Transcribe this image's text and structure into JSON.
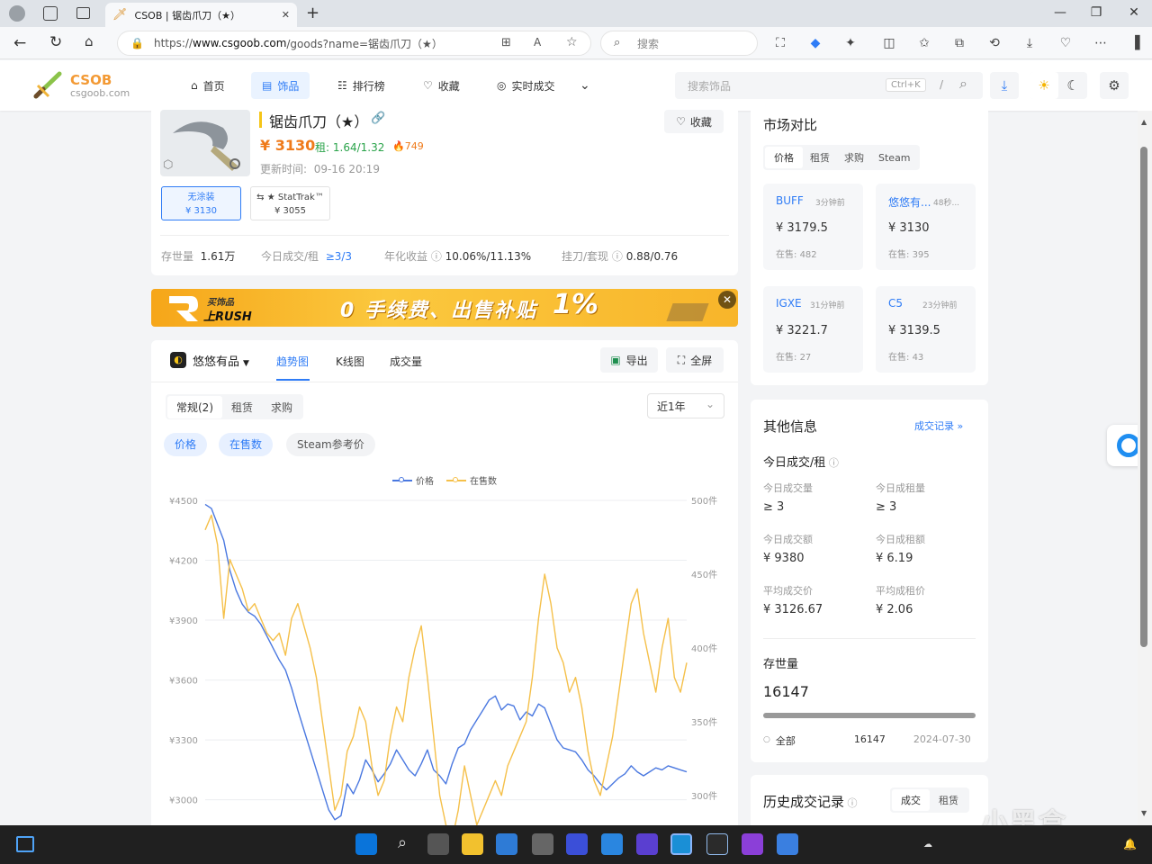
{
  "browser": {
    "tab_title": "CSOB | 锯齿爪刀（★）",
    "url_prefix": "https://",
    "url_host": "www.csgoob.com",
    "url_path": "/goods?name=锯齿爪刀（★）",
    "search_placeholder": "搜索",
    "tab_close": "✕",
    "new_tab": "+"
  },
  "site": {
    "logo_title": "CSOB",
    "logo_sub": "csgoob.com",
    "nav": [
      "首页",
      "饰品",
      "排行榜",
      "收藏",
      "实时成交"
    ],
    "search_placeholder": "搜索饰品",
    "shortcut": "Ctrl+K",
    "slash": "/"
  },
  "item": {
    "name": "锯齿爪刀（★）",
    "fav_label": "收藏",
    "price": "¥ 3130",
    "rent_label": "租:",
    "rent_value": "1.64/1.32",
    "hot": "749",
    "updated_label": "更新时间:",
    "updated_value": "09-16 20:19",
    "variants": [
      {
        "name": "无涂装",
        "price": "¥ 3130"
      },
      {
        "name": "★ StatTrak™",
        "price": "¥ 3055"
      }
    ],
    "stats": [
      {
        "label": "存世量",
        "value": "1.61万"
      },
      {
        "label": "今日成交/租",
        "value": "≥3/3"
      },
      {
        "label": "年化收益",
        "value": "10.06%/11.13%"
      },
      {
        "label": "挂刀/套现",
        "value": "0.88/0.76"
      }
    ]
  },
  "banner": {
    "brand_top": "买饰品",
    "brand_bottom": "上RUSH",
    "slogan": "0 手续费、出售补贴",
    "highlight": "1%"
  },
  "chart_panel": {
    "platform": "悠悠有品",
    "tabs": [
      "趋势图",
      "K线图",
      "成交量"
    ],
    "export": "导出",
    "fullscreen": "全屏",
    "subtabs": [
      "常规(2)",
      "租赁",
      "求购"
    ],
    "range": "近1年",
    "pills": [
      "价格",
      "在售数",
      "Steam参考价"
    ],
    "legend": [
      "价格",
      "在售数"
    ]
  },
  "chart_data": {
    "type": "line",
    "y_left_ticks": [
      "¥4500",
      "¥4200",
      "¥3900",
      "¥3600",
      "¥3300",
      "¥3000"
    ],
    "y_right_ticks": [
      "500件",
      "450件",
      "400件",
      "350件",
      "300件"
    ],
    "ylim_left": [
      2800,
      4500
    ],
    "ylim_right": [
      270,
      500
    ],
    "series": [
      {
        "name": "价格",
        "color": "#4a78e0",
        "values": [
          4480,
          4460,
          4380,
          4300,
          4150,
          4050,
          3980,
          3940,
          3920,
          3880,
          3820,
          3760,
          3700,
          3650,
          3560,
          3450,
          3350,
          3250,
          3150,
          3050,
          2950,
          2900,
          2920,
          3080,
          3030,
          3100,
          3200,
          3150,
          3090,
          3130,
          3180,
          3250,
          3200,
          3150,
          3120,
          3180,
          3250,
          3150,
          3120,
          3080,
          3180,
          3260,
          3280,
          3350,
          3400,
          3450,
          3500,
          3520,
          3450,
          3480,
          3470,
          3400,
          3440,
          3420,
          3480,
          3460,
          3380,
          3300,
          3260,
          3250,
          3240,
          3200,
          3150,
          3120,
          3080,
          3050,
          3080,
          3110,
          3130,
          3170,
          3140,
          3120,
          3140,
          3160,
          3150,
          3170,
          3160,
          3150,
          3140
        ]
      },
      {
        "name": "在售数",
        "color": "#f5c04a",
        "values": [
          480,
          490,
          470,
          420,
          460,
          450,
          440,
          425,
          430,
          420,
          410,
          405,
          410,
          395,
          420,
          430,
          415,
          400,
          380,
          350,
          320,
          290,
          300,
          330,
          340,
          360,
          350,
          320,
          300,
          310,
          340,
          360,
          350,
          380,
          400,
          415,
          380,
          340,
          300,
          280,
          270,
          290,
          320,
          300,
          280,
          290,
          300,
          310,
          300,
          320,
          330,
          340,
          350,
          380,
          420,
          450,
          430,
          400,
          390,
          370,
          380,
          360,
          330,
          310,
          300,
          320,
          340,
          370,
          400,
          430,
          440,
          410,
          390,
          370,
          400,
          420,
          380,
          370,
          390
        ]
      }
    ]
  },
  "market": {
    "title": "市场对比",
    "tabs": [
      "价格",
      "租赁",
      "求购",
      "Steam"
    ],
    "cards": [
      {
        "name": "BUFF",
        "time": "3分钟前",
        "price": "¥ 3179.5",
        "count_label": "在售:",
        "count": "482"
      },
      {
        "name": "悠悠有...",
        "time": "48秒...",
        "price": "¥ 3130",
        "count_label": "在售:",
        "count": "395"
      },
      {
        "name": "IGXE",
        "time": "31分钟前",
        "price": "¥ 3221.7",
        "count_label": "在售:",
        "count": "27"
      },
      {
        "name": "C5",
        "time": "23分钟前",
        "price": "¥ 3139.5",
        "count_label": "在售:",
        "count": "43"
      }
    ]
  },
  "other": {
    "title": "其他信息",
    "link": "成交记录",
    "section": "今日成交/租",
    "metrics": [
      {
        "label": "今日成交量",
        "value": "≥ 3"
      },
      {
        "label": "今日成租量",
        "value": "≥ 3"
      },
      {
        "label": "今日成交额",
        "value": "¥ 9380"
      },
      {
        "label": "今日成租额",
        "value": "¥ 6.19"
      },
      {
        "label": "平均成交价",
        "value": "¥ 3126.67"
      },
      {
        "label": "平均成租价",
        "value": "¥ 2.06"
      }
    ],
    "stock_title": "存世量",
    "stock_value": "16147",
    "stock_row": {
      "label": "全部",
      "value": "16147",
      "date": "2024-07-30"
    }
  },
  "history": {
    "title": "历史成交记录",
    "tabs": [
      "成交",
      "租赁"
    ]
  },
  "watermark": "小黑盒"
}
